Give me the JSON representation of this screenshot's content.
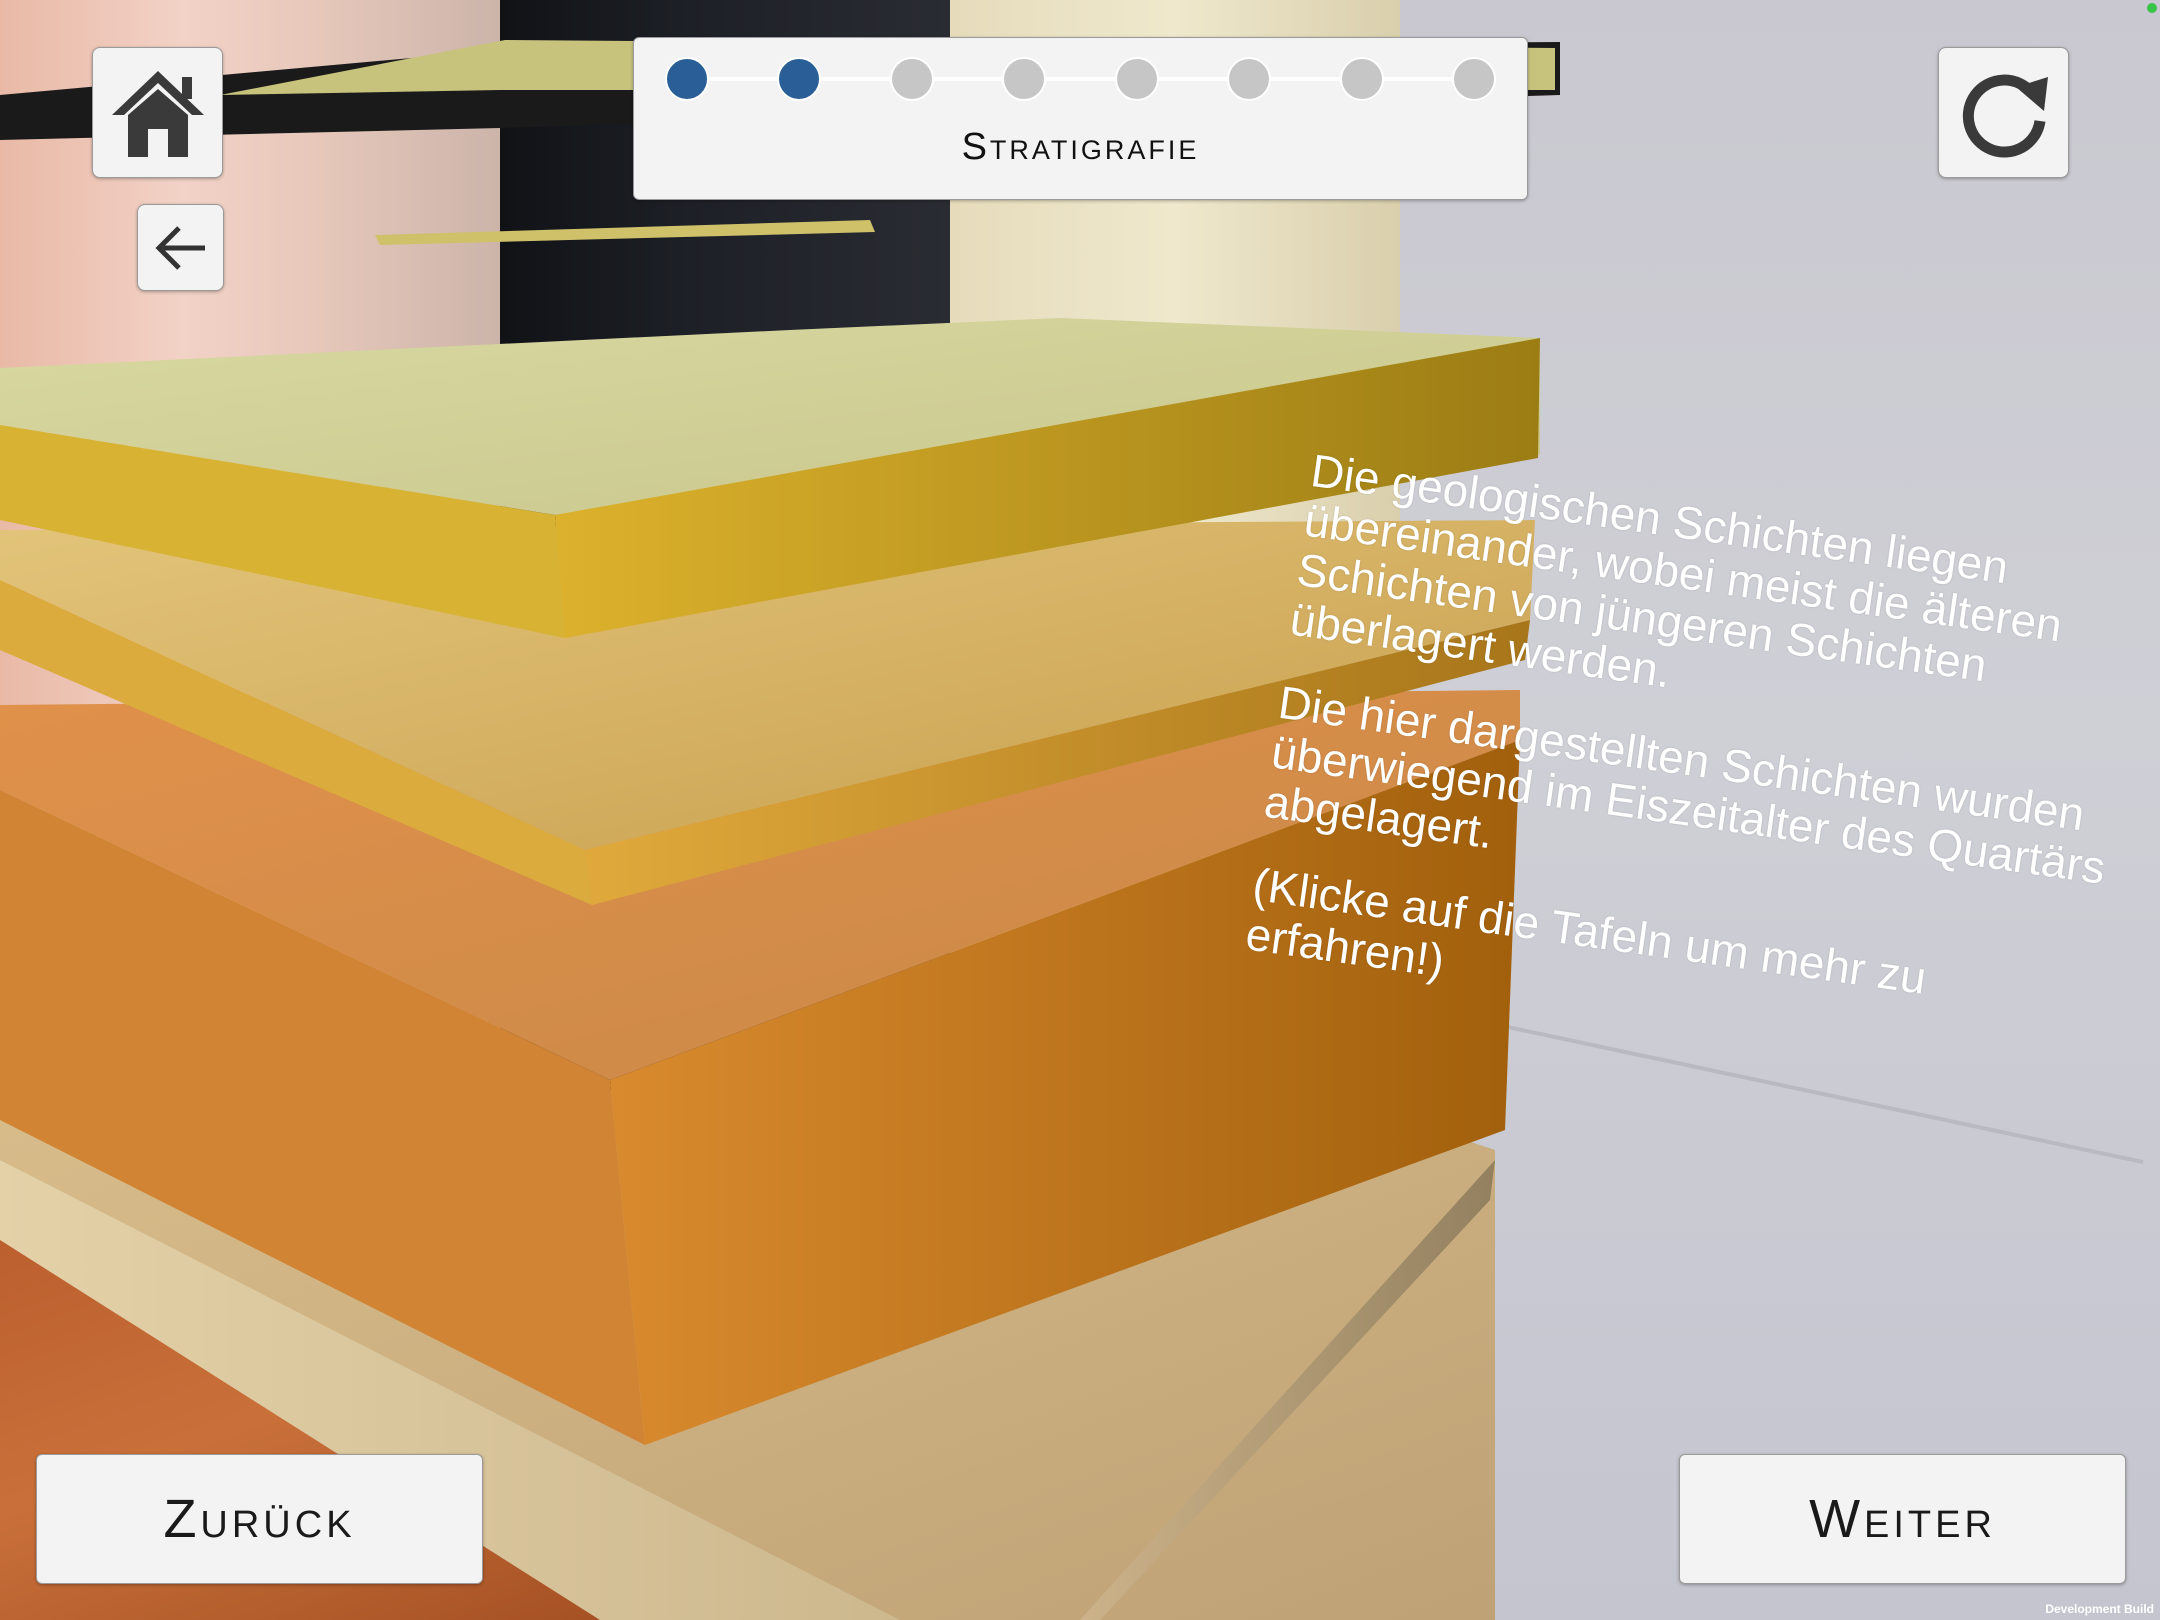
{
  "progress": {
    "title": "Stratigrafie",
    "total_steps": 8,
    "current_step": 2,
    "active_color": "#2a5e96",
    "inactive_color": "#c6c6c6"
  },
  "info": {
    "paragraph_1": "Die geologischen Schichten liegen übereinander, wobei meist die älteren Schichten von jüngeren Schichten überlagert werden.",
    "paragraph_2": "Die hier dargestellten Schichten wurden überwiegend  im Eiszeitalter des Quartärs abgelagert.",
    "paragraph_3": "(Klicke auf die Tafeln um mehr zu erfahren!)"
  },
  "nav": {
    "prev_label": "Zurück",
    "next_label": "Weiter"
  },
  "icons": {
    "home": "home-icon",
    "back": "arrow-left-icon",
    "refresh": "refresh-icon"
  },
  "footer": {
    "build_label": "Development Build"
  },
  "layers": [
    "top-yellow-layer",
    "yellow-ochre-layer",
    "orange-layer",
    "beige-bottom-layer"
  ]
}
